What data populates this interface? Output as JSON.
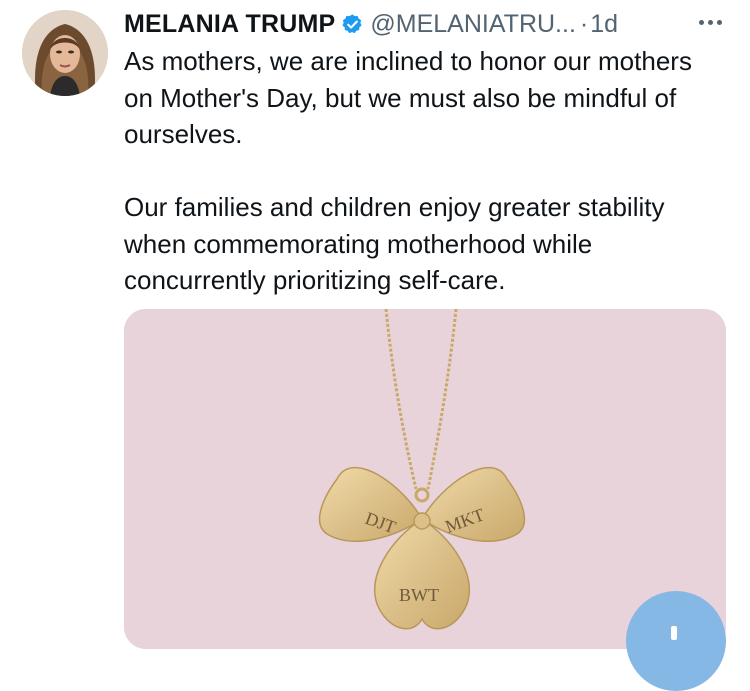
{
  "tweet": {
    "author_name": "MELANIA TRUMP",
    "handle": "@MELANIATRU...",
    "separator": "·",
    "time": "1d",
    "text": "As mothers, we are inclined to honor our mothers on Mother's Day, but we must also be mindful of ourselves.\n\nOur families and children enjoy greater stability when commemorating motherhood while concurrently prioritizing self-care.",
    "media": {
      "pendant_engravings": {
        "left": "DJT",
        "right": "MKT",
        "bottom": "BWT"
      }
    }
  },
  "icons": {
    "verified": "verified-badge-icon",
    "more": "more-options-icon",
    "compose": "compose-plus-icon"
  },
  "colors": {
    "verified_blue": "#1d9bf0",
    "media_background": "#e8d3db",
    "fab_blue": "#86b8e5",
    "secondary_text": "#536471"
  }
}
